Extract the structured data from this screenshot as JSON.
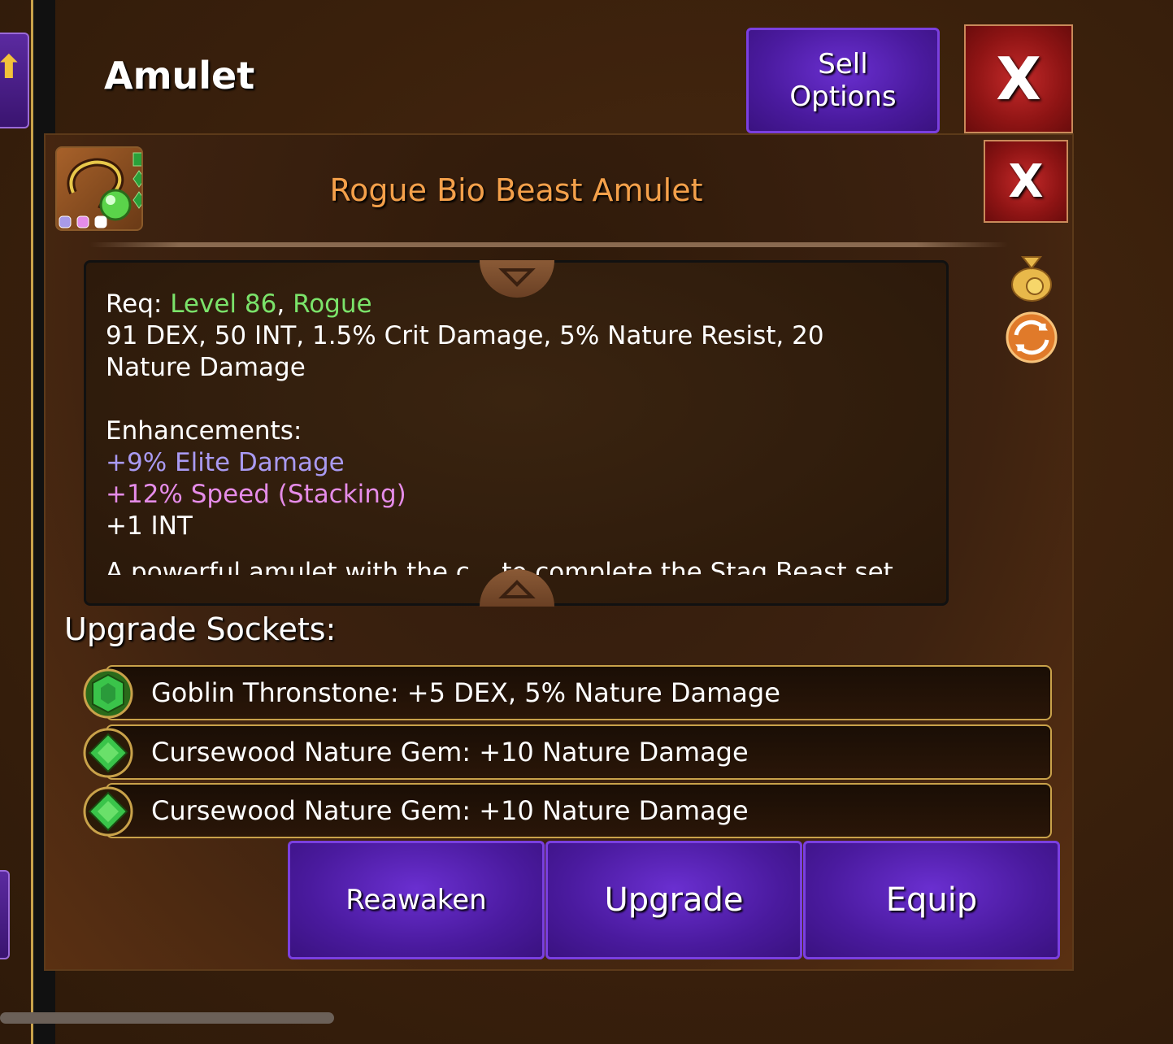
{
  "page_title": "Amulet",
  "sell_button": {
    "line1": "Sell",
    "line2": "Options"
  },
  "close_label": "X",
  "item": {
    "name": "Rogue Bio Beast Amulet",
    "req_label": "Req:",
    "req_level": "Level 86",
    "req_sep": ",",
    "req_class": "Rogue",
    "stats": "91 DEX, 50 INT, 1.5% Crit Damage, 5% Nature Resist, 20 Nature Damage",
    "enhancements_label": "Enhancements:",
    "enhancements": [
      {
        "text": "+9% Elite Damage",
        "color": "#a99af2"
      },
      {
        "text": "+12% Speed (Stacking)",
        "color": "#e58ce8"
      },
      {
        "text": "+1 INT",
        "color": "#ffffff"
      }
    ],
    "description_partial": "A powerful amulet with the c... to complete the Stag Beast set"
  },
  "upgrade_sockets": {
    "title": "Upgrade Sockets:",
    "items": [
      {
        "text": "Goblin Thronstone: +5 DEX, 5% Nature Damage",
        "gem": "thronstone-icon"
      },
      {
        "text": "Cursewood Nature Gem: +10 Nature Damage",
        "gem": "nature-gem-icon"
      },
      {
        "text": "Cursewood Nature Gem: +10 Nature Damage",
        "gem": "nature-gem-icon"
      }
    ]
  },
  "actions": {
    "reawaken": "Reawaken",
    "upgrade": "Upgrade",
    "equip": "Equip"
  },
  "colors": {
    "item_name": "#f4a04a",
    "req_highlight": "#7be36a",
    "purple_button": "#4a1a9e",
    "close_red": "#8e1414",
    "gold_border": "#c9a24a"
  }
}
